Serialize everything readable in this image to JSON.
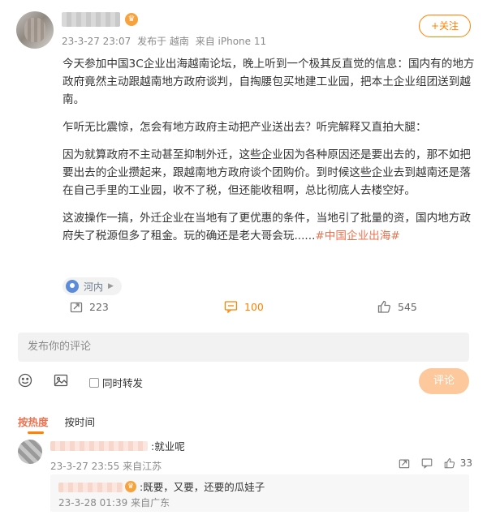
{
  "post": {
    "author_badge": "♛",
    "date": "23-3-27 23:07",
    "published_in": "发布于 越南",
    "device": "来自 iPhone 11",
    "follow_label": "+关注",
    "paragraphs": [
      "今天参加中国3C企业出海越南论坛，晚上听到一个极其反直觉的信息：国内有的地方政府竟然主动跟越南地方政府谈判，自掏腰包买地建工业园，把本土企业组团送到越南。",
      "乍听无比震惊，怎会有地方政府主动把产业送出去？听完解释又直拍大腿：",
      "因为就算政府不主动甚至抑制外迁，这些企业因为各种原因还是要出去的，那不如把要出去的企业攒起来，跟越南地方政府谈个团购价。到时候这些企业去到越南还是落在自己手里的工业园，收不了税，但还能收租啊，总比彻底人去楼空好。",
      "这波操作一搞，外迁企业在当地有了更优惠的条件，当地引了批量的资，国内地方政府失了税源但多了租金。玩的确还是老大哥会玩......"
    ],
    "topic": "#中国企业出海#",
    "location": "河内",
    "forward_count": "223",
    "comment_count": "100",
    "like_count": "545"
  },
  "composer": {
    "placeholder": "发布你的评论",
    "repost_label": "同时转发",
    "submit_label": "评论"
  },
  "sort_tabs": [
    "按热度",
    "按时间"
  ],
  "comments": [
    {
      "text": ":就业呢",
      "date": "23-3-27 23:55",
      "location": "来自江苏",
      "like_count": "33"
    }
  ],
  "reply": {
    "badge": "♛",
    "text": ":既要，又要，还要的瓜娃子",
    "date": "23-3-28 01:39",
    "location": "来自广东"
  },
  "colors": {
    "accent": "#ff8200",
    "topic": "#eb7350",
    "submit_disabled": "#fcc89c"
  }
}
